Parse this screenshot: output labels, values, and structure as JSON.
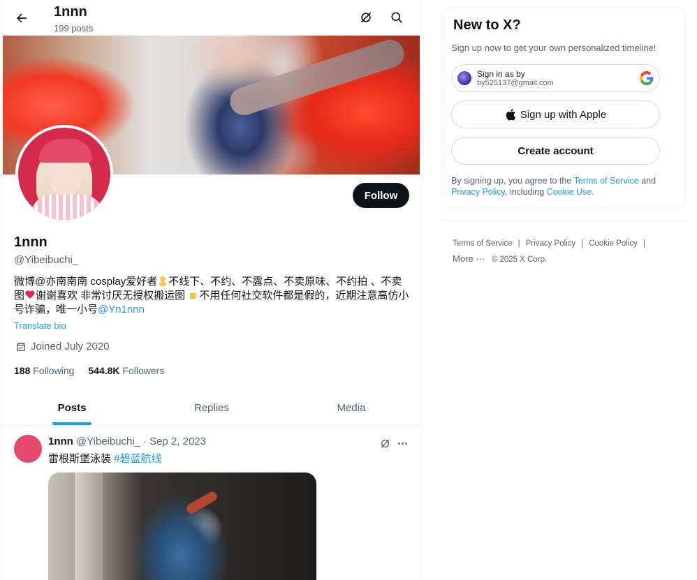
{
  "header": {
    "title": "1nnn",
    "subtitle": "199 posts"
  },
  "profile": {
    "name": "1nnn",
    "handle": "@Yibeibuchi_",
    "follow_label": "Follow",
    "bio_part1": "微博@亦南南南 cosplay爱好者",
    "bio_part2": "不线下、不约、不露点、不卖原味、不约拍 、不卖图",
    "bio_part3": "谢谢喜欢 非常讨厌无授权搬运图 ",
    "bio_part4": "不用任何社交软件都是假的，近期注意高仿小号诈骗，唯一小号",
    "bio_link": "@Yn1nnn",
    "translate_label": "Translate bio",
    "joined": "Joined July 2020",
    "following_count": "188",
    "following_label": "Following",
    "followers_count": "544.8K",
    "followers_label": "Followers"
  },
  "tabs": [
    {
      "label": "Posts",
      "active": true
    },
    {
      "label": "Replies",
      "active": false
    },
    {
      "label": "Media",
      "active": false
    }
  ],
  "tweet": {
    "author": "1nnn",
    "handle": "@Yibeibuchi_",
    "dot": "·",
    "date": "Sep 2, 2023",
    "text": "雷根斯堡泳装 ",
    "hashtag": "#碧蓝航线"
  },
  "signup": {
    "title": "New to X?",
    "subtitle": "Sign up now to get your own personalized timeline!",
    "google_line1": "Sign in as by",
    "google_line2": "by525137@gmail.com",
    "apple_label": "Sign up with Apple",
    "create_label": "Create account",
    "legal_prefix": "By signing up, you agree to the ",
    "legal_tos": "Terms of Service",
    "legal_and": " and ",
    "legal_privacy": "Privacy Policy",
    "legal_including": ", including ",
    "legal_cookie": "Cookie Use",
    "legal_end": "."
  },
  "footer": {
    "links": [
      "Terms of Service",
      "Privacy Policy",
      "Cookie Policy"
    ],
    "separator": "|",
    "more": "More ···",
    "copyright": "© 2025 X Corp."
  },
  "colors": {
    "accent": "#1d9bf0",
    "text_primary": "#0f1419",
    "text_secondary": "#536471",
    "follow_bg": "#0f1419"
  }
}
